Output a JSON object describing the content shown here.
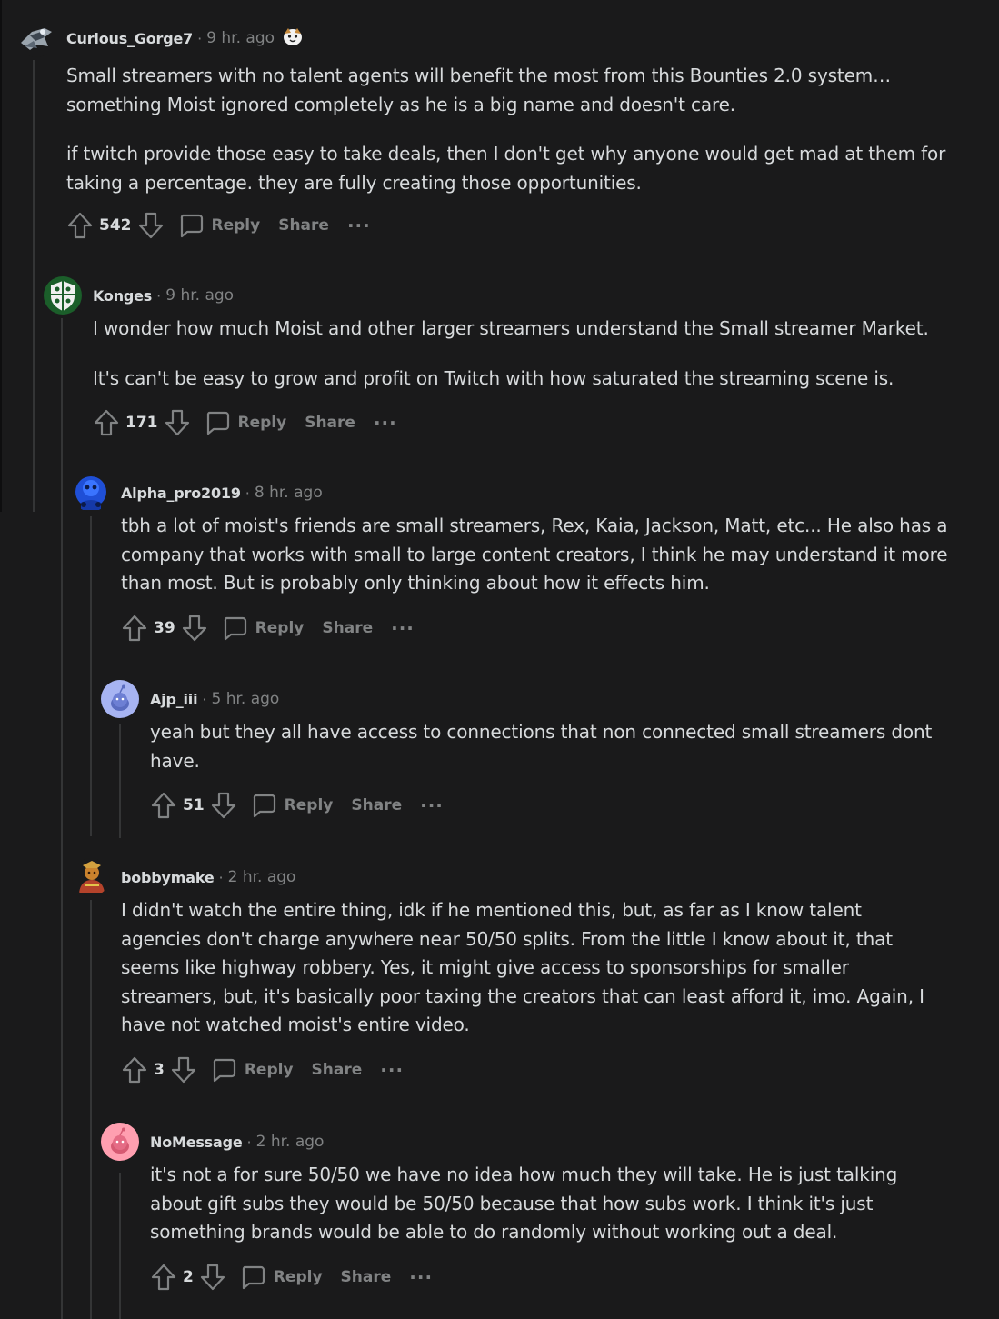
{
  "comments": [
    {
      "author": "Curious_Gorge7",
      "time": "9 hr. ago",
      "paragraphs": [
        "Small streamers with no talent agents will benefit the most from this Bounties 2.0 system… something Moist ignored completely as he is a big name and doesn't care.",
        "if twitch provide those easy to take deals, then I don't get why anyone would get mad at them for taking a percentage. they are fully creating those opportunities."
      ],
      "score": "542"
    },
    {
      "author": "Konges",
      "time": "9 hr. ago",
      "paragraphs": [
        "I wonder how much Moist and other larger streamers understand the Small streamer Market.",
        "It's can't be easy to grow and profit on Twitch with how saturated the streaming scene is."
      ],
      "score": "171"
    },
    {
      "author": "Alpha_pro2019",
      "time": "8 hr. ago",
      "paragraphs": [
        "tbh a lot of moist's friends are small streamers, Rex, Kaia, Jackson, Matt, etc... He also has a company that works with small to large content creators, I think he may understand it more than most. But is probably only thinking about how it effects him."
      ],
      "score": "39"
    },
    {
      "author": "Ajp_iii",
      "time": "5 hr. ago",
      "paragraphs": [
        "yeah but they all have access to connections that non connected small streamers dont have."
      ],
      "score": "51"
    },
    {
      "author": "bobbymake",
      "time": "2 hr. ago",
      "paragraphs": [
        "I didn't watch the entire thing, idk if he mentioned this, but, as far as I know talent agencies don't charge anywhere near 50/50 splits. From the little I know about it, that seems like highway robbery. Yes, it might give access to sponsorships for smaller streamers, but, it's basically poor taxing the creators that can least afford it, imo. Again, I have not watched moist's entire video."
      ],
      "score": "3"
    },
    {
      "author": "NoMessage",
      "time": "2 hr. ago",
      "paragraphs": [
        "it's not a for sure 50/50 we have no idea how much they will take. He is just talking about gift subs they would be 50/50 because that how subs work. I think it's just something brands would be able to do randomly without working out a deal."
      ],
      "score": "2"
    }
  ],
  "labels": {
    "separator": "·",
    "reply": "Reply",
    "share": "Share",
    "more": "···"
  },
  "colors": {
    "background": "#1a1a1b",
    "text": "#d7dadc",
    "muted": "#818384",
    "thread_line": "#343536"
  }
}
